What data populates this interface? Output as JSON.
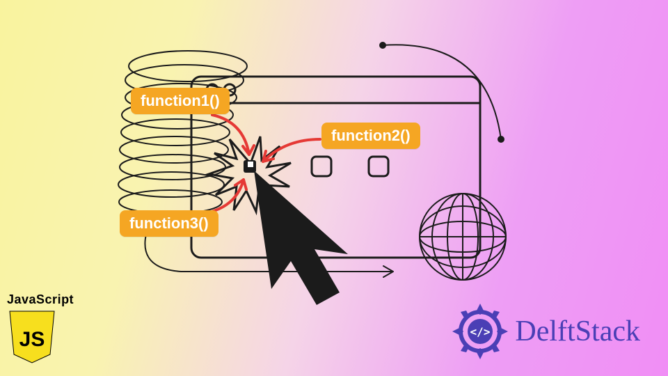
{
  "labels": {
    "fn1": "function1()",
    "fn2": "function2()",
    "fn3": "function3()"
  },
  "logos": {
    "js_title": "JavaScript",
    "js_mono": "JS",
    "delft": "DelftStack"
  },
  "colors": {
    "badge_bg": "#f5a623",
    "badge_fg": "#ffffff",
    "arrow": "#e53935",
    "stroke": "#1b1b1b",
    "js_yellow": "#f7df1e",
    "delft_blue": "#4a3fb5"
  }
}
